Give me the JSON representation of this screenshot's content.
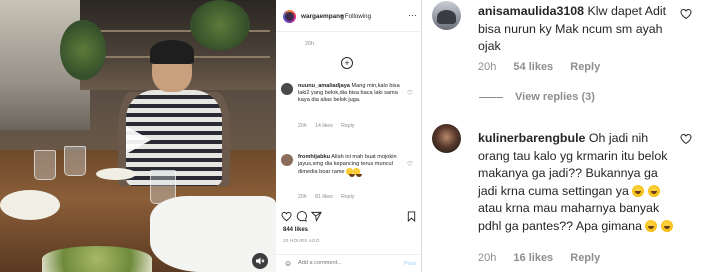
{
  "video": {
    "play_icon": "play-icon",
    "mute_icon": "speaker-muted-icon"
  },
  "instagram": {
    "header": {
      "username": "wargaempang",
      "follow_status": "• Following",
      "more_icon": "more-horizontal-icon",
      "more_label": "···"
    },
    "caption_time": "20h",
    "load_more_icon": "plus-circle-icon",
    "load_more_label": "+",
    "comments": [
      {
        "username": "nuunu_amaliadjaya",
        "text": "Mang min,kalo bisa laki2 yang belok,dia bisa baca laki sama kaya dia alias belok juga.",
        "time": "20h",
        "likes": "14 likes",
        "reply": "Reply",
        "heart_icon": "heart-outline-icon",
        "heart": "♡"
      },
      {
        "username": "fromhijabku",
        "text": "Allah ini mah buat mojokin jayus,smg dia kepancing terus muncul dimedia boar rame",
        "time": "20h",
        "likes": "81 likes",
        "reply": "Reply",
        "heart_icon": "heart-outline-icon",
        "heart": "♡"
      }
    ],
    "actions": {
      "like_icon": "heart-outline-icon",
      "comment_icon": "comment-bubble-icon",
      "share_icon": "paper-plane-icon",
      "save_icon": "bookmark-icon"
    },
    "likes_count": "844 likes",
    "post_age": "20 HOURS AGO",
    "add_comment": {
      "emoji_icon": "smiley-icon",
      "emoji": "☺",
      "placeholder": "Add a comment...",
      "post_label": "Post"
    }
  },
  "zoomed_comments": [
    {
      "username": "anisamaulida3108",
      "text": "Klw dapet Adit bisa nurun ky Mak ncum sm ayah ojak",
      "time": "20h",
      "likes": "54 likes",
      "reply": "Reply",
      "view_replies": "View replies (3)",
      "heart_icon": "heart-outline-icon"
    },
    {
      "username": "kulinerbarengbule",
      "text_1": "Oh jadi nih orang tau kalo yg krmarin itu belok makanya ga jadi?? Bukannya ga jadi krna cuma settingan ya",
      "text_2": "atau krna mau maharnya banyak pdhl ga pantes?? Apa gimana",
      "emoji_icon": "grinning-sweat-emoji-icon",
      "time": "20h",
      "likes": "16 likes",
      "reply": "Reply",
      "heart_icon": "heart-outline-icon"
    }
  ],
  "colors": {
    "text_primary": "#262626",
    "text_secondary": "#8e8e8e",
    "divider": "#dbdbdb",
    "post_button_disabled": "#b2dffc"
  }
}
